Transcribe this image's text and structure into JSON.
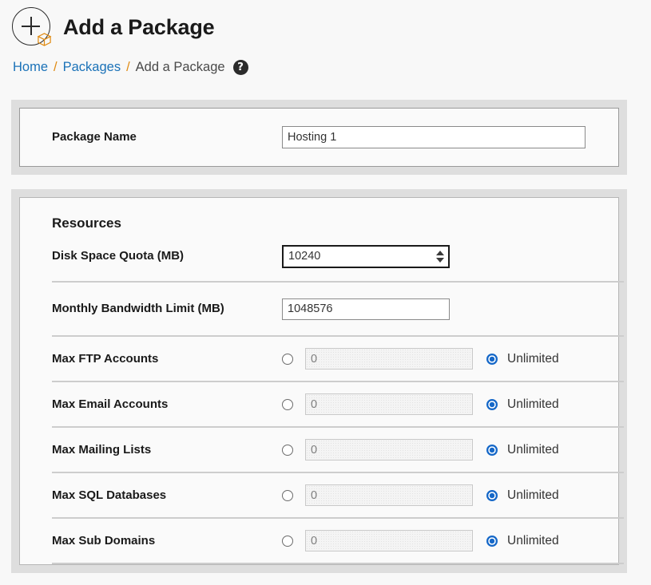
{
  "header": {
    "title": "Add a Package",
    "icon": "add-package-circle-plus-box-icon"
  },
  "breadcrumb": {
    "home": "Home",
    "sep1": "/",
    "packages": "Packages",
    "sep2": "/",
    "current": "Add a Package",
    "help_glyph": "?"
  },
  "package_panel": {
    "label": "Package Name",
    "value": "Hosting 1",
    "placeholder": ""
  },
  "resources": {
    "title": "Resources",
    "disk": {
      "label": "Disk Space Quota (MB)",
      "value": "10240"
    },
    "bandwidth": {
      "label": "Monthly Bandwidth Limit (MB)",
      "value": "1048576"
    },
    "unlimited_label": "Unlimited",
    "rows": [
      {
        "label": "Max FTP Accounts",
        "value": "0",
        "unlimited": "Unlimited"
      },
      {
        "label": "Max Email Accounts",
        "value": "0",
        "unlimited": "Unlimited"
      },
      {
        "label": "Max Mailing Lists",
        "value": "0",
        "unlimited": "Unlimited"
      },
      {
        "label": "Max SQL Databases",
        "value": "0",
        "unlimited": "Unlimited"
      },
      {
        "label": "Max Sub Domains",
        "value": "0",
        "unlimited": "Unlimited"
      }
    ]
  },
  "colors": {
    "link": "#1b72b8",
    "separator": "#e08b13",
    "radio_selected": "#1668c8",
    "panel_bg": "#dedede",
    "page_bg": "#f8f8f8"
  }
}
